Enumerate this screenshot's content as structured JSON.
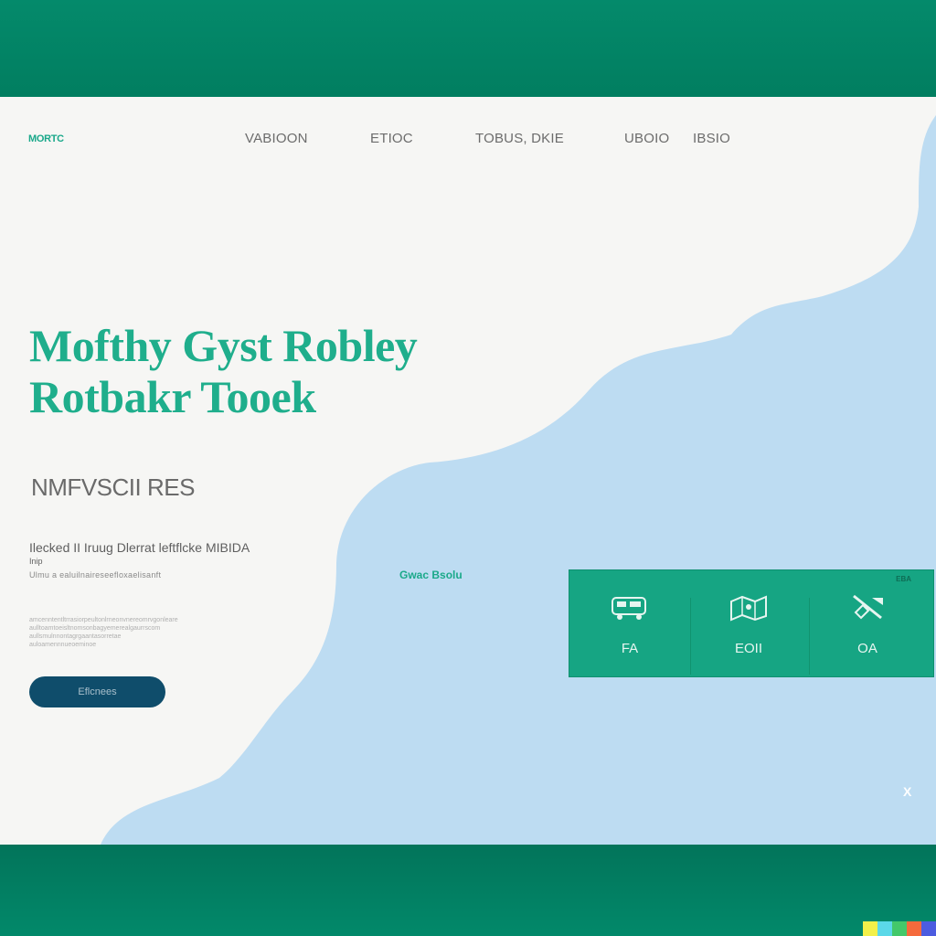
{
  "header": {
    "logo": "MORTC",
    "nav": [
      "VABIOON",
      "ETIOC",
      "TOBUS, DKIE",
      "UBOIO",
      "IBSIO"
    ]
  },
  "hero": {
    "title_line1": "Mofthy Gyst Robley",
    "title_line2": "Rotbakr Tooek",
    "subtitle": "NMFVSCII RES",
    "lead": "Ilecked II Iruug Dlerrat leftflcke MIBIDA",
    "lead_extra": "Inip",
    "lead_small": "Ulmu a ealuilnaireseefloxaelisanft",
    "fine_print": [
      "amcenntentltrrasiorpeultonlrneonvnereomrvgonleare",
      "aulltoamtoeisltnomsonbagyemerealgaurrscom",
      "aullsmulnnontagrgaantasorretae",
      "auloamennnueoeminoe"
    ],
    "cta_label": "Eflcnees"
  },
  "panel": {
    "label": "Gwac Bsolu",
    "tag": "EBA",
    "items": [
      {
        "icon": "vehicle-icon",
        "label": "FA"
      },
      {
        "icon": "map-icon",
        "label": "EOII"
      },
      {
        "icon": "tool-icon",
        "label": "OA"
      }
    ]
  },
  "footer": {
    "corner_mark": "X"
  },
  "colors": {
    "brand_green": "#028566",
    "accent_teal": "#1fae8c",
    "wave_blue": "#bddcf2",
    "button_navy": "#0f4d6b",
    "page_bg": "#f6f6f4"
  },
  "swatches": [
    "#f2f04a",
    "#5bd8e8",
    "#43c86a",
    "#f56a3c",
    "#4c5ce0"
  ]
}
